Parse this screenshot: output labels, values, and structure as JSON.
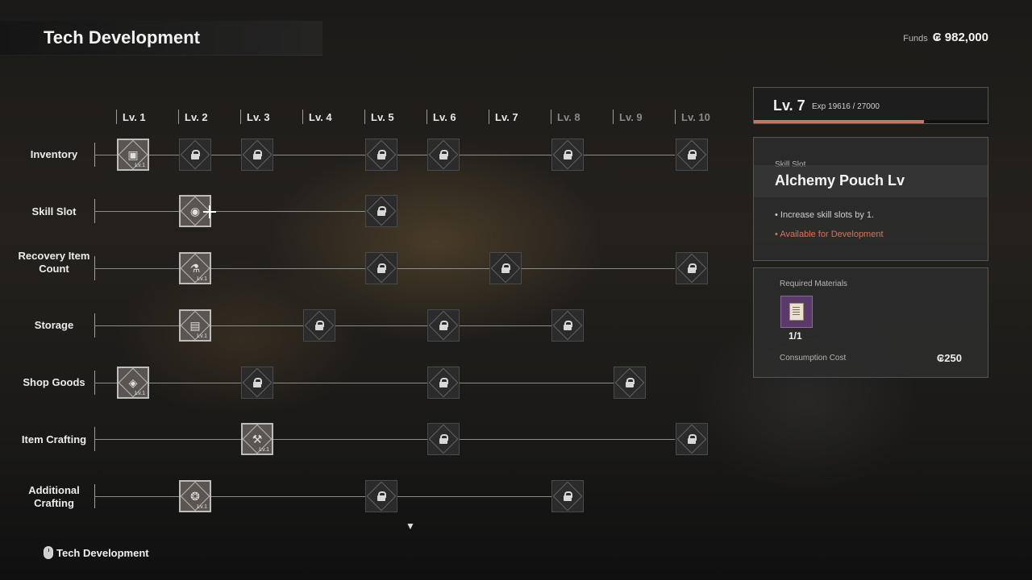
{
  "header": {
    "title": "Tech Development"
  },
  "funds": {
    "label": "Funds",
    "value": "982,000"
  },
  "levels": [
    "Lv. 1",
    "Lv. 2",
    "Lv. 3",
    "Lv. 4",
    "Lv. 5",
    "Lv. 6",
    "Lv. 7",
    "Lv. 8",
    "Lv. 9",
    "Lv. 10"
  ],
  "rows": [
    {
      "label": "Inventory"
    },
    {
      "label": "Skill Slot"
    },
    {
      "label": "Recovery Item Count"
    },
    {
      "label": "Storage"
    },
    {
      "label": "Shop Goods"
    },
    {
      "label": "Item Crafting"
    },
    {
      "label": "Additional Crafting"
    }
  ],
  "node_sub": "Lv.1",
  "level_panel": {
    "level": "Lv. 7",
    "exp": "Exp 19616 / 27000",
    "exp_current": 19616,
    "exp_max": 27000
  },
  "detail": {
    "category": "Skill Slot",
    "name": "Alchemy Pouch Lv",
    "bullets": [
      "Increase skill slots by 1.",
      "Available for Development"
    ]
  },
  "materials": {
    "label": "Required Materials",
    "quantity": "1/1",
    "cost_label": "Consumption Cost",
    "cost": "250"
  },
  "footer": {
    "label": "Tech Development"
  },
  "colors": {
    "accent": "#c9765f",
    "available": "#d9735a",
    "material_bg": "#5b3a6b"
  }
}
